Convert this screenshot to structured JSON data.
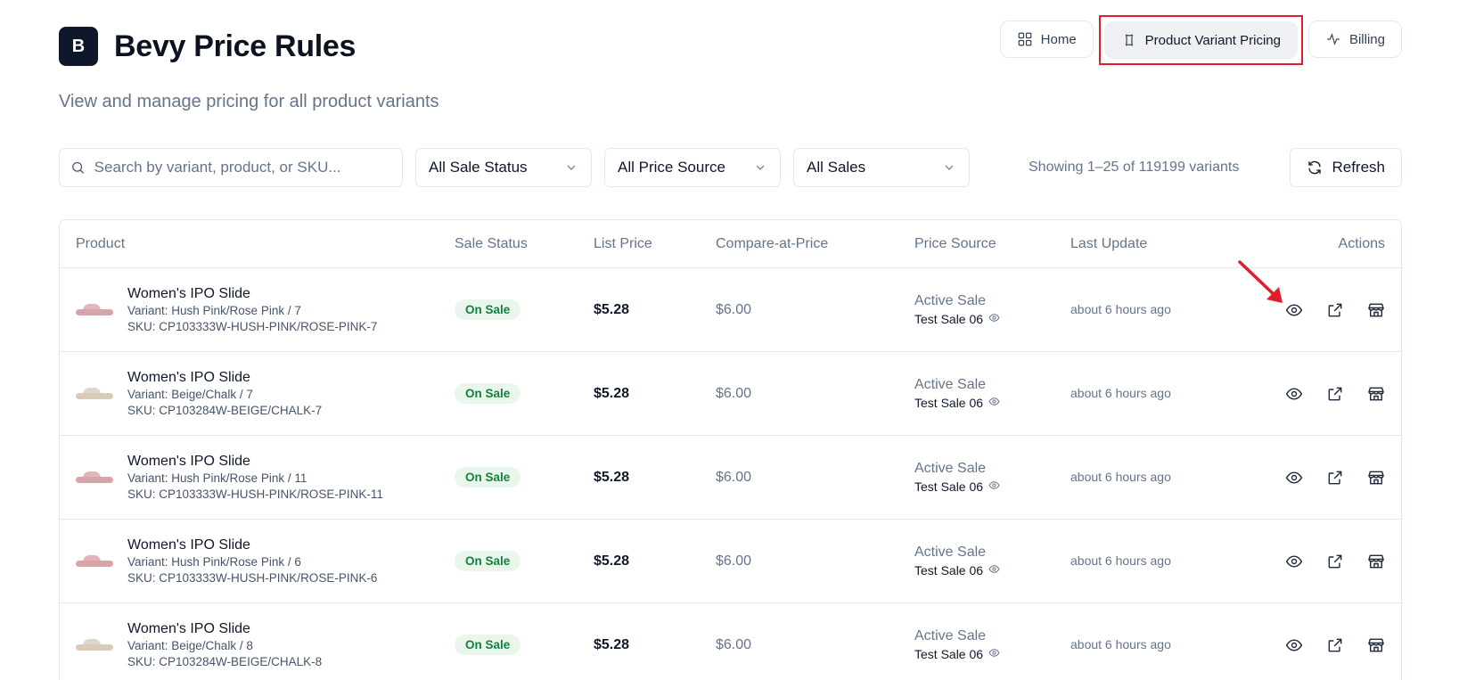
{
  "app": {
    "logo_letter": "B",
    "title": "Bevy Price Rules",
    "subtitle": "View and manage pricing for all product variants"
  },
  "nav": {
    "home": "Home",
    "variant_pricing": "Product Variant Pricing",
    "billing": "Billing"
  },
  "toolbar": {
    "search_placeholder": "Search by variant, product, or SKU...",
    "filter_sale_status": "All Sale Status",
    "filter_price_source": "All Price Source",
    "filter_sales": "All Sales",
    "showing": "Showing 1–25 of 119199 variants",
    "refresh": "Refresh"
  },
  "table": {
    "headers": {
      "product": "Product",
      "sale_status": "Sale Status",
      "list_price": "List Price",
      "compare_at": "Compare-at-Price",
      "price_source": "Price Source",
      "last_update": "Last Update",
      "actions": "Actions"
    },
    "rows": [
      {
        "name": "Women's IPO Slide",
        "variant": "Variant: Hush Pink/Rose Pink / 7",
        "sku": "SKU: CP103333W-HUSH-PINK/ROSE-PINK-7",
        "status": "On Sale",
        "list_price": "$5.28",
        "compare": "$6.00",
        "source": "Active Sale",
        "sale_name": "Test Sale 06",
        "updated": "about 6 hours ago",
        "color": "pink"
      },
      {
        "name": "Women's IPO Slide",
        "variant": "Variant: Beige/Chalk / 7",
        "sku": "SKU: CP103284W-BEIGE/CHALK-7",
        "status": "On Sale",
        "list_price": "$5.28",
        "compare": "$6.00",
        "source": "Active Sale",
        "sale_name": "Test Sale 06",
        "updated": "about 6 hours ago",
        "color": "beige"
      },
      {
        "name": "Women's IPO Slide",
        "variant": "Variant: Hush Pink/Rose Pink / 11",
        "sku": "SKU: CP103333W-HUSH-PINK/ROSE-PINK-11",
        "status": "On Sale",
        "list_price": "$5.28",
        "compare": "$6.00",
        "source": "Active Sale",
        "sale_name": "Test Sale 06",
        "updated": "about 6 hours ago",
        "color": "pink"
      },
      {
        "name": "Women's IPO Slide",
        "variant": "Variant: Hush Pink/Rose Pink / 6",
        "sku": "SKU: CP103333W-HUSH-PINK/ROSE-PINK-6",
        "status": "On Sale",
        "list_price": "$5.28",
        "compare": "$6.00",
        "source": "Active Sale",
        "sale_name": "Test Sale 06",
        "updated": "about 6 hours ago",
        "color": "pink"
      },
      {
        "name": "Women's IPO Slide",
        "variant": "Variant: Beige/Chalk / 8",
        "sku": "SKU: CP103284W-BEIGE/CHALK-8",
        "status": "On Sale",
        "list_price": "$5.28",
        "compare": "$6.00",
        "source": "Active Sale",
        "sale_name": "Test Sale 06",
        "updated": "about 6 hours ago",
        "color": "beige"
      }
    ]
  },
  "colors": {
    "accent_dark": "#0f172a",
    "highlight_red": "#e11d2a",
    "on_sale_bg": "#e8f6ec",
    "on_sale_text": "#15803d",
    "pink_product": "#d9a3aa",
    "beige_product": "#d8cbb8"
  }
}
